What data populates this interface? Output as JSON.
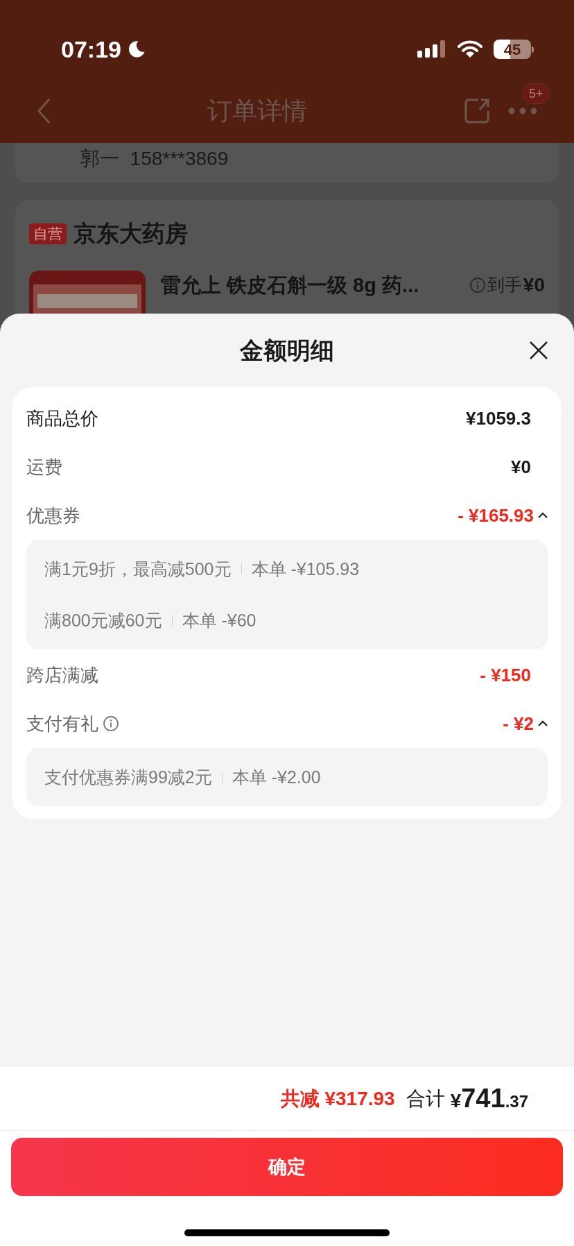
{
  "status_bar": {
    "time": "07:19",
    "battery": "45"
  },
  "background_page": {
    "title": "订单详情",
    "badge": "5+",
    "contact": "郭一  158***3869",
    "store_tag": "自营",
    "store_name": "京东大药房",
    "product_title": "雷允上 铁皮石斛一级 8g 药...",
    "price_label": "到手",
    "price": "¥0"
  },
  "sheet": {
    "title": "金额明细",
    "rows": [
      {
        "kind": "plain",
        "label": "商品总价",
        "value": "¥1059.3",
        "emphasis": true,
        "discount": false,
        "info": false
      },
      {
        "kind": "plain",
        "label": "运费",
        "value": "¥0",
        "emphasis": false,
        "discount": false,
        "info": false
      },
      {
        "kind": "expandable",
        "label": "优惠券",
        "value": "- ¥165.93",
        "emphasis": false,
        "discount": true,
        "info": false,
        "expanded": true,
        "details": [
          {
            "desc": "满1元9折，最高减500元",
            "amount": "本单 -¥105.93"
          },
          {
            "desc": "满800元减60元",
            "amount": "本单 -¥60"
          }
        ]
      },
      {
        "kind": "plain",
        "label": "跨店满减",
        "value": "- ¥150",
        "emphasis": false,
        "discount": true,
        "info": false
      },
      {
        "kind": "expandable",
        "label": "支付有礼",
        "value": "- ¥2",
        "emphasis": false,
        "discount": true,
        "info": true,
        "expanded": true,
        "details": [
          {
            "desc": "支付优惠券满99减2元",
            "amount": "本单 -¥2.00"
          }
        ]
      }
    ],
    "footer": {
      "reduce_label": "共减",
      "reduce_amount": "¥317.93",
      "total_label": "合计",
      "currency": "¥",
      "total_int": "741",
      "total_dec": ".37"
    },
    "confirm": "确定"
  }
}
